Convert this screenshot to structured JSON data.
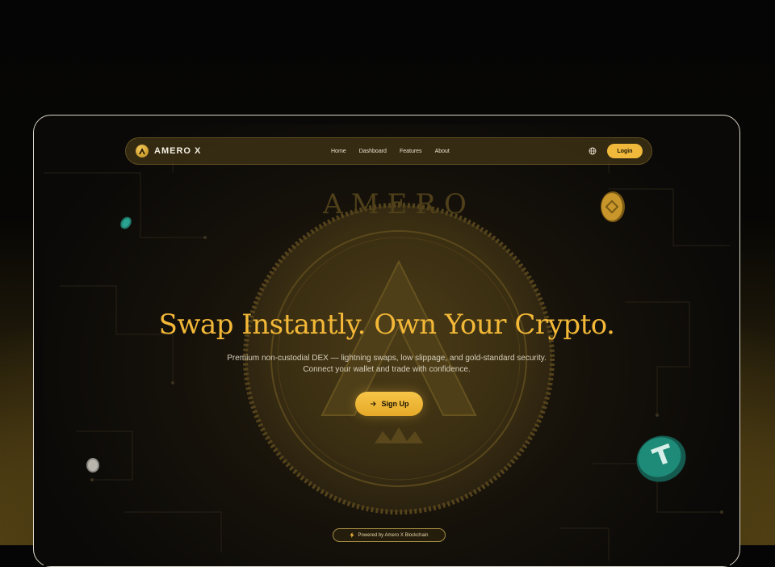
{
  "brand": {
    "name": "AMERO X"
  },
  "nav": {
    "links": [
      "Home",
      "Dashboard",
      "Features",
      "About"
    ],
    "login_label": "Login"
  },
  "hero": {
    "title": "Swap Instantly. Own Your Crypto.",
    "subtitle_line1": "Premium non-custodial DEX — lightning swaps, low slippage, and gold-standard security.",
    "subtitle_line2": "Connect your wallet and trade with confidence.",
    "cta_label": "Sign Up"
  },
  "footer_badge": {
    "label": "Powered by Amero X Blockchain"
  },
  "colors": {
    "accent": "#f0b93b",
    "title": "#f3b838",
    "background": "#0a0908"
  },
  "icons": [
    "brand-logo-icon",
    "globe-icon",
    "arrow-right-icon",
    "lightning-icon"
  ]
}
